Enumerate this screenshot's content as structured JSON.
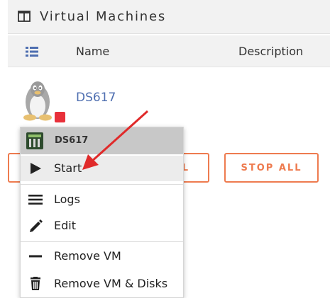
{
  "panel": {
    "title": "Virtual Machines"
  },
  "table": {
    "columns": [
      "Name",
      "Description"
    ]
  },
  "vm": {
    "name": "DS617",
    "status_color": "#e8303a"
  },
  "buttons": {
    "start_all": "LL",
    "stop_all": "STOP ALL"
  },
  "context_menu": {
    "header": "DS617",
    "items": [
      {
        "label": "Start",
        "icon": "play-icon"
      },
      {
        "label": "Logs",
        "icon": "list-icon"
      },
      {
        "label": "Edit",
        "icon": "pencil-icon"
      },
      {
        "label": "Remove VM",
        "icon": "minus-icon"
      },
      {
        "label": "Remove VM & Disks",
        "icon": "trash-icon"
      }
    ]
  },
  "colors": {
    "accent": "#ee7b4f",
    "link": "#4e6eb0",
    "arrow": "#e02a2a"
  }
}
